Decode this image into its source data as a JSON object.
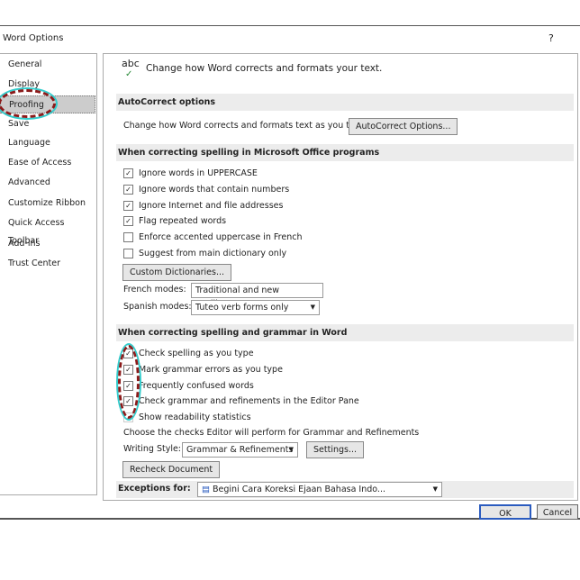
{
  "window": {
    "title": "Word Options",
    "help": "?"
  },
  "nav": {
    "items": [
      "General",
      "Display",
      "Proofing",
      "Save",
      "Language",
      "Ease of Access",
      "Advanced",
      "Customize Ribbon",
      "Quick Access Toolbar",
      "Add-ins",
      "Trust Center"
    ],
    "selected": "Proofing"
  },
  "header": {
    "icon_text": "abc",
    "text": "Change how Word corrects and formats your text."
  },
  "autocorrect": {
    "title": "AutoCorrect options",
    "label": "Change how Word corrects and formats text as you type:",
    "button": "AutoCorrect Options..."
  },
  "office": {
    "title": "When correcting spelling in Microsoft Office programs",
    "options": [
      {
        "label": "Ignore words in UPPERCASE",
        "checked": true
      },
      {
        "label": "Ignore words that contain numbers",
        "checked": true
      },
      {
        "label": "Ignore Internet and file addresses",
        "checked": true
      },
      {
        "label": "Flag repeated words",
        "checked": true
      },
      {
        "label": "Enforce accented uppercase in French",
        "checked": false
      },
      {
        "label": "Suggest from main dictionary only",
        "checked": false
      }
    ],
    "custom_dict_button": "Custom Dictionaries...",
    "french_label": "French modes:",
    "french_value": "Traditional and new spellings",
    "spanish_label": "Spanish modes:",
    "spanish_value": "Tuteo verb forms only"
  },
  "word": {
    "title": "When correcting spelling and grammar in Word",
    "options": [
      {
        "label": "Check spelling as you type",
        "checked": true
      },
      {
        "label": "Mark grammar errors as you type",
        "checked": true
      },
      {
        "label": "Frequently confused words",
        "checked": true
      },
      {
        "label": "Check grammar and refinements in the Editor Pane",
        "checked": true
      },
      {
        "label": "Show readability statistics",
        "checked": false
      }
    ],
    "choose_text": "Choose the checks Editor will perform for Grammar and Refinements",
    "style_label": "Writing Style:",
    "style_value": "Grammar & Refinements",
    "settings_button": "Settings...",
    "recheck_button": "Recheck Document"
  },
  "exceptions": {
    "label": "Exceptions for:",
    "value": "Begini Cara Koreksi Ejaan Bahasa Indo..."
  },
  "footer": {
    "ok": "OK",
    "cancel": "Cancel"
  },
  "colors": {
    "annotation_red": "#8b1a1a",
    "annotation_cyan": "#33cccc"
  }
}
